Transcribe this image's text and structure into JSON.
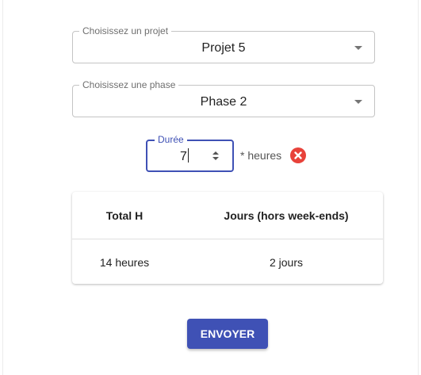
{
  "form": {
    "project": {
      "label": "Choisissez un projet",
      "value": "Projet 5"
    },
    "phase": {
      "label": "Choisissez une phase",
      "value": "Phase 2"
    },
    "duration": {
      "label": "Durée",
      "value": "7",
      "unit_text": "* heures"
    }
  },
  "summary": {
    "headers": [
      "Total H",
      "Jours (hors week-ends)"
    ],
    "rows": [
      [
        "14 heures",
        "2 jours"
      ]
    ]
  },
  "actions": {
    "submit_label": "ENVOYER"
  },
  "colors": {
    "primary": "#3f51b5",
    "error": "#e8423a"
  },
  "icons": {
    "select_arrow": "chevron-down-icon",
    "clear": "close-circle-icon",
    "spinner": "spinner-arrows-icon"
  }
}
